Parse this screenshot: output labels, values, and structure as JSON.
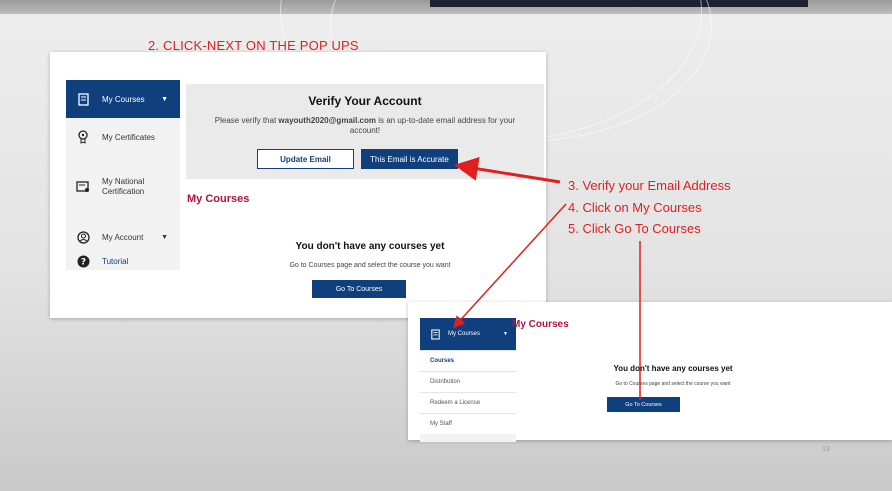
{
  "step2": "2. CLICK-NEXT ON THE POP UPS",
  "sidebar": {
    "my_courses": "My Courses",
    "my_certificates": "My Certificates",
    "my_national_certification": "My National Certification",
    "my_account": "My Account",
    "tutorial": "Tutorial"
  },
  "verify": {
    "title": "Verify Your Account",
    "text_before": "Please verify that ",
    "email": "wayouth2020@gmail.com",
    "text_after": " is an up-to-date email address for your account!",
    "update_button": "Update Email",
    "accurate_button": "This Email is Accurate"
  },
  "courses": {
    "heading": "My Courses",
    "empty_title": "You don't have any courses yet",
    "empty_text": "Go to Courses page and select the course you want",
    "go_button": "Go To Courses"
  },
  "panel2": {
    "sidebar_label": "My Courses",
    "submenu": [
      "Courses",
      "Distribution",
      "Redeem a License",
      "My Staff"
    ],
    "heading": "My Courses",
    "empty_title": "You don't have any courses yet",
    "empty_text": "Go to Courses page and select the course you want",
    "go_button": "Go To Courses"
  },
  "instructions": [
    "3. Verify your Email Address",
    "4. Click on My Courses",
    "5. Click Go To Courses"
  ],
  "page_number": "13",
  "colors": {
    "navy": "#0f3f7d",
    "annotation_red": "#e02020",
    "heading_crimson": "#b3123c"
  }
}
